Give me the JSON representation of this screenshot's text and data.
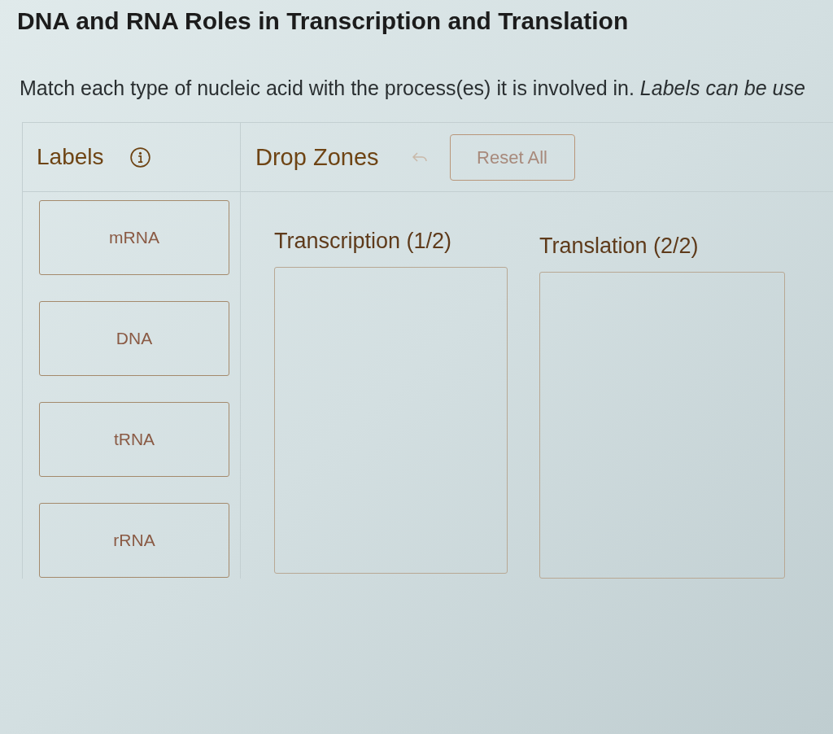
{
  "title": "DNA and RNA Roles in Transcription and Translation",
  "instructions": "Match each type of nucleic acid with the process(es) it is involved in. *Labels can be use*",
  "labels_panel": {
    "heading": "Labels",
    "labels": [
      {
        "text": "mRNA"
      },
      {
        "text": "DNA"
      },
      {
        "text": "tRNA"
      },
      {
        "text": "rRNA"
      }
    ]
  },
  "drop_panel": {
    "heading": "Drop Zones",
    "undo": {
      "disabled": true
    },
    "reset_button": {
      "label": "Reset All",
      "disabled": true
    },
    "zones": [
      {
        "title": "Transcription (1/2)"
      },
      {
        "title": "Translation (2/2)"
      }
    ]
  }
}
